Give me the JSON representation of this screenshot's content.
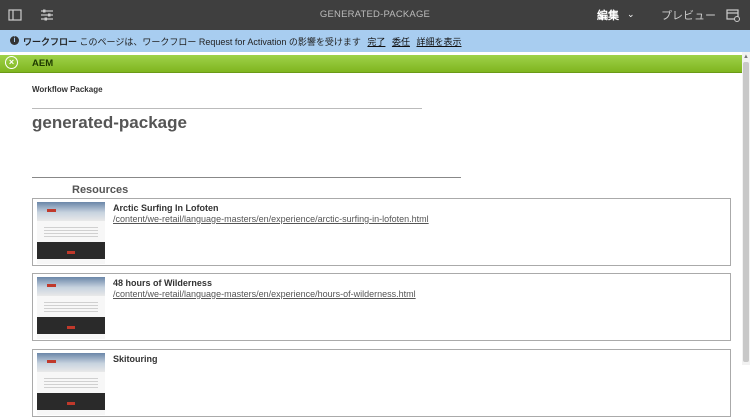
{
  "topbar": {
    "title": "GENERATED-PACKAGE",
    "edit_label": "編集",
    "edit_chevron": "⌄",
    "preview_label": "プレビュー"
  },
  "notice": {
    "heading": "ワークフロー",
    "message": "このページは、ワークフロー Request for Activation の影響を受けます",
    "links": [
      "完了",
      "委任",
      "詳細を表示"
    ]
  },
  "aem": {
    "label": "AEM",
    "icon": "aem-icon"
  },
  "content": {
    "workflow_package_label": "Workflow Package",
    "package_title": "generated-package",
    "resources_heading": "Resources"
  },
  "resources": [
    {
      "title": "Arctic Surfing In Lofoten",
      "path": "/content/we-retail/language-masters/en/experience/arctic-surfing-in-lofoten.html"
    },
    {
      "title": "48 hours of Wilderness",
      "path": "/content/we-retail/language-masters/en/experience/hours-of-wilderness.html"
    },
    {
      "title": "Skitouring",
      "path": ""
    }
  ],
  "colors": {
    "topbar": "#3f3f3f",
    "notice": "#a8cdf0",
    "aem_bar": "#8ec43a"
  }
}
